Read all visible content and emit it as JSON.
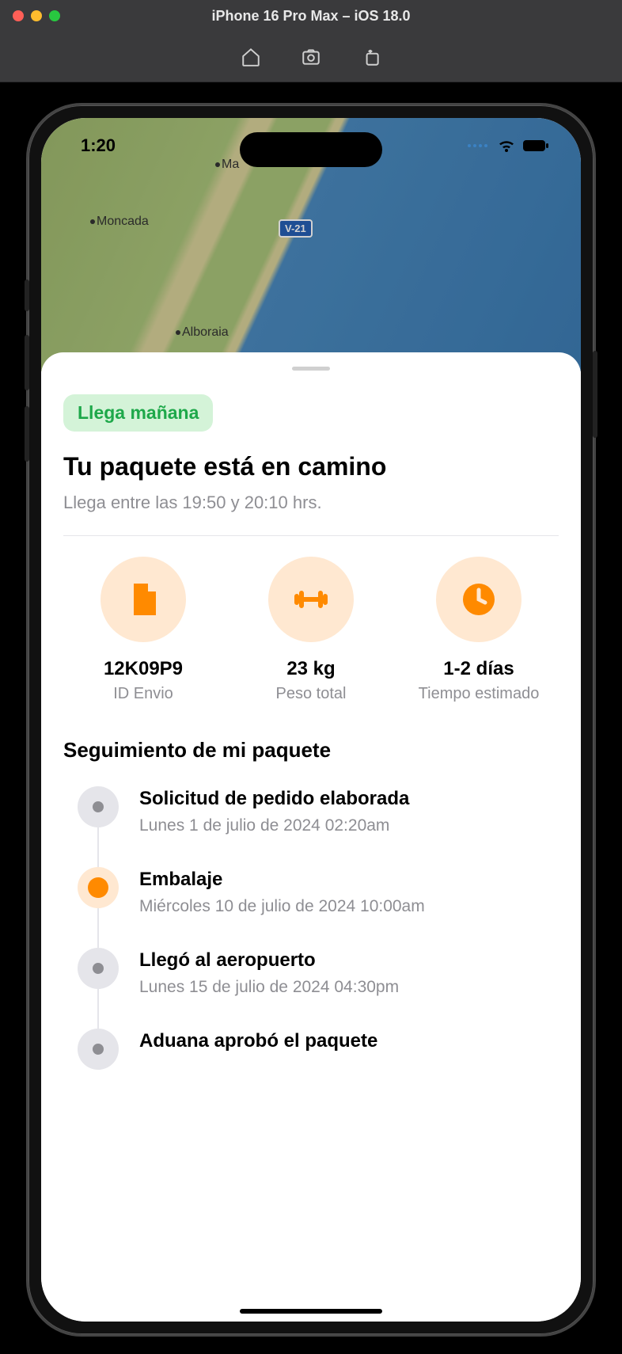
{
  "simulator": {
    "title": "iPhone 16 Pro Max – iOS 18.0"
  },
  "statusbar": {
    "time": "1:20"
  },
  "map": {
    "labels": [
      "Ma",
      "Moncada",
      "Alboraia"
    ],
    "road_sign": "V-21"
  },
  "sheet": {
    "badge": "Llega mañana",
    "title": "Tu paquete está en camino",
    "subtitle": "Llega entre las 19:50 y 20:10 hrs.",
    "stats": [
      {
        "value": "12K09P9",
        "label": "ID Envio",
        "icon": "document"
      },
      {
        "value": "23 kg",
        "label": "Peso total",
        "icon": "dumbbell"
      },
      {
        "value": "1-2 días",
        "label": "Tiempo estimado",
        "icon": "clock"
      }
    ],
    "tracking_heading": "Seguimiento de mi paquete",
    "timeline": [
      {
        "title": "Solicitud de pedido elaborada",
        "date": "Lunes 1 de julio de 2024 02:20am",
        "state": "done"
      },
      {
        "title": "Embalaje",
        "date": "Miércoles 10 de julio de 2024 10:00am",
        "state": "active"
      },
      {
        "title": "Llegó al aeropuerto",
        "date": "Lunes 15 de julio de 2024 04:30pm",
        "state": "done"
      },
      {
        "title": "Aduana aprobó el paquete",
        "date": "",
        "state": "done"
      }
    ]
  },
  "colors": {
    "accent": "#ff8a00",
    "badge_bg": "#d4f3d8",
    "badge_text": "#1ea84a"
  }
}
